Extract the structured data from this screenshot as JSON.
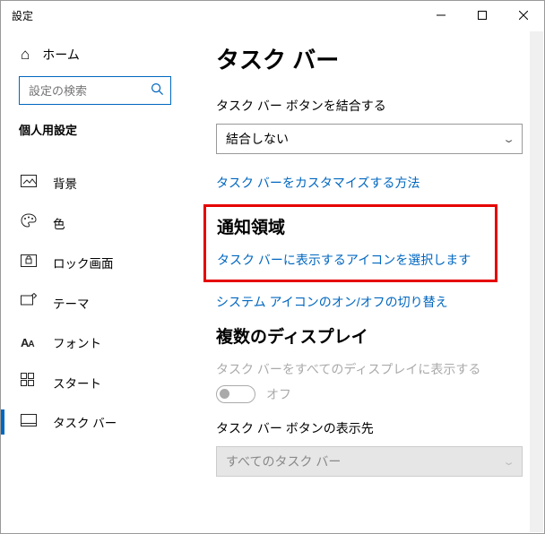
{
  "window": {
    "title": "設定"
  },
  "sidebar": {
    "home": "ホーム",
    "search_placeholder": "設定の検索",
    "category": "個人用設定",
    "items": [
      {
        "label": "背景"
      },
      {
        "label": "色"
      },
      {
        "label": "ロック画面"
      },
      {
        "label": "テーマ"
      },
      {
        "label": "フォント"
      },
      {
        "label": "スタート"
      },
      {
        "label": "タスク バー"
      }
    ]
  },
  "main": {
    "title": "タスク バー",
    "combine_label": "タスク バー ボタンを結合する",
    "combine_value": "結合しない",
    "customize_link": "タスク バーをカスタマイズする方法",
    "notification_title": "通知領域",
    "select_icons_link": "タスク バーに表示するアイコンを選択します",
    "system_icons_link": "システム アイコンのオン/オフの切り替え",
    "multi_title": "複数のディスプレイ",
    "show_all_label": "タスク バーをすべてのディスプレイに表示する",
    "toggle_state": "オフ",
    "show_where_label": "タスク バー ボタンの表示先",
    "show_where_value": "すべてのタスク バー"
  }
}
